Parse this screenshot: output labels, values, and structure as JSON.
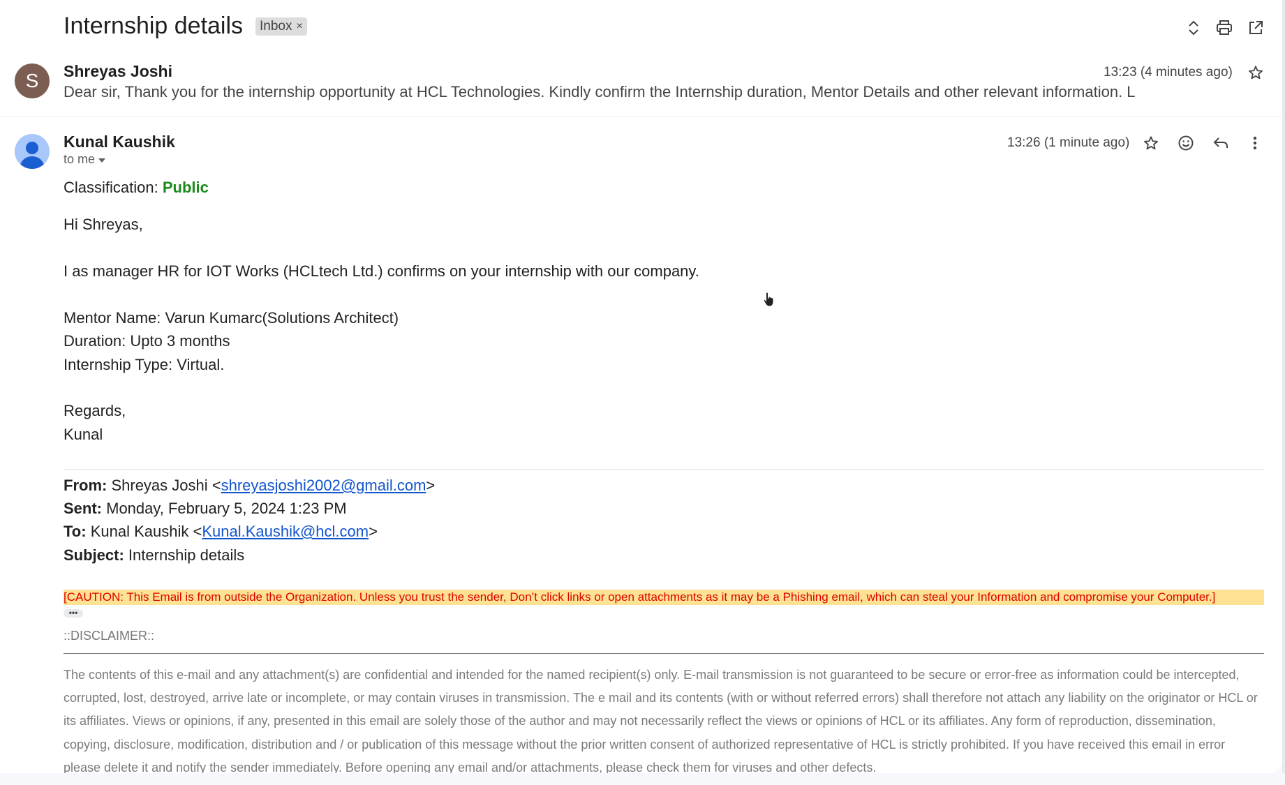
{
  "thread": {
    "subject": "Internship details",
    "label": "Inbox",
    "label_remove": "×"
  },
  "header_icons": [
    "expand-collapse-icon",
    "print-icon",
    "open-in-new-window-icon"
  ],
  "message1": {
    "avatar_letter": "S",
    "sender": "Shreyas Joshi",
    "time": "13:23 (4 minutes ago)",
    "snippet": "Dear sir, Thank you for the internship opportunity at HCL Technologies. Kindly confirm the Internship duration, Mentor Details and other relevant information. L"
  },
  "message2": {
    "sender": "Kunal Kaushik",
    "time": "13:26 (1 minute ago)",
    "to_me": "to me",
    "classification_label": "Classification:",
    "classification_value": "Public",
    "greeting": "Hi Shreyas,",
    "line1": "I as manager HR for IOT Works (HCLtech Ltd.) confirms on your internship with our company.",
    "mentor": "Mentor Name: Varun Kumarc(Solutions Architect)",
    "duration": "Duration: Upto 3 months",
    "type": "Internship Type: Virtual.",
    "regards": "Regards,",
    "signoff": "Kunal",
    "quoted": {
      "from_label": "From:",
      "from_name": "Shreyas Joshi <",
      "from_email": "shreyasjoshi2002@gmail.com",
      "from_close": ">",
      "sent_label": "Sent:",
      "sent_value": "Monday, February 5, 2024 1:23 PM",
      "to_label": "To:",
      "to_name": "Kunal Kaushik <",
      "to_email": "Kunal.Kaushik@hcl.com",
      "to_close": ">",
      "subject_label": "Subject:",
      "subject_value": "Internship details"
    },
    "caution": "[CAUTION: This Email is from outside the Organization. Unless you trust the sender, Don’t click links or open attachments as it may be a Phishing email, which can steal your Information and compromise your Computer.]",
    "ellipsis": "•••",
    "disclaimer_heading": "::DISCLAIMER::",
    "disclaimer": "The contents of this e-mail and any attachment(s) are confidential and intended for the named recipient(s) only. E-mail transmission is not guaranteed to be secure or error-free as information could be intercepted, corrupted, lost, destroyed, arrive late or incomplete, or may contain viruses in transmission. The e mail and its contents (with or without referred errors) shall therefore not attach any liability on the originator or HCL or its affiliates. Views or opinions, if any, presented in this email are solely those of the author and may not necessarily reflect the views or opinions of HCL or its affiliates. Any form of reproduction, dissemination, copying, disclosure, modification, distribution and / or publication of this message without the prior written consent of authorized representative of HCL is strictly prohibited. If you have received this email in error please delete it and notify the sender immediately. Before opening any email and/or attachments, please check them for viruses and other defects."
  },
  "colors": {
    "classification_public": "#1a8a1a",
    "caution_bg": "#fde293",
    "caution_text": "#e00000",
    "link": "#1155cc",
    "avatar_s": "#7c5d52",
    "avatar_person": "#a8c7fa"
  }
}
